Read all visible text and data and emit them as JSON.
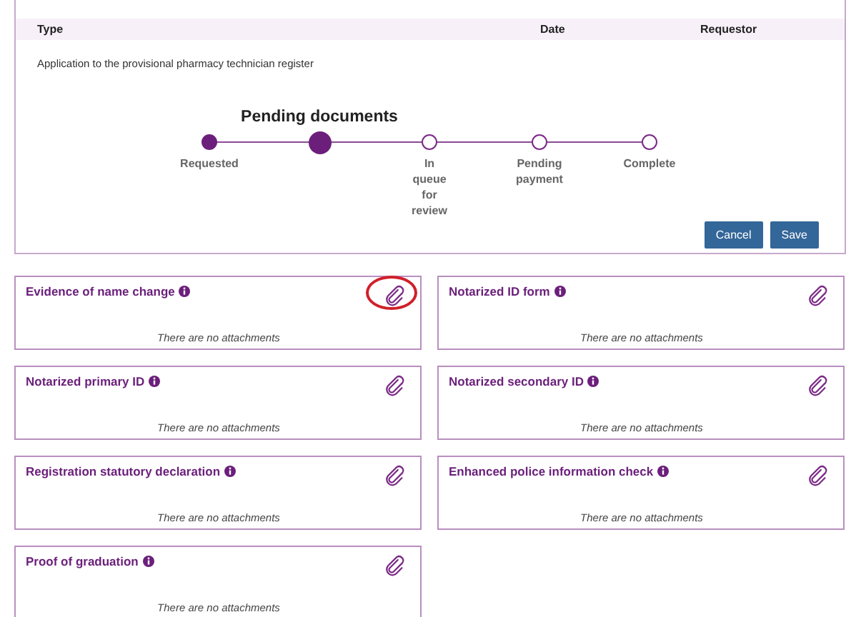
{
  "table": {
    "columns": [
      "Type",
      "Date",
      "Requestor"
    ],
    "rows": [
      [
        "Application to the provisional pharmacy technician register"
      ]
    ]
  },
  "progress": {
    "steps": [
      {
        "label": "Requested",
        "completed": true,
        "current": false
      },
      {
        "label": "Pending documents",
        "completed": false,
        "current": true
      },
      {
        "label": "In queue for review",
        "completed": false,
        "current": false
      },
      {
        "label": "Pending payment",
        "completed": false,
        "current": false
      },
      {
        "label": "Complete",
        "completed": false,
        "current": false
      }
    ]
  },
  "buttons": [
    "Cancel",
    "Save"
  ],
  "documents": [
    {
      "title": "Evidence of name change",
      "empty_text": "There are no attachments",
      "highlighted": true
    },
    {
      "title": "Notarized ID form",
      "empty_text": "There are no attachments",
      "highlighted": false
    },
    {
      "title": "Notarized primary ID",
      "empty_text": "There are no attachments",
      "highlighted": false
    },
    {
      "title": "Notarized secondary ID",
      "empty_text": "There are no attachments",
      "highlighted": false
    },
    {
      "title": "Registration statutory declaration",
      "empty_text": "There are no attachments",
      "highlighted": false
    },
    {
      "title": "Enhanced police information check",
      "empty_text": "There are no attachments",
      "highlighted": false
    },
    {
      "title": "Proof of graduation",
      "empty_text": "There are no attachments",
      "highlighted": false
    }
  ]
}
